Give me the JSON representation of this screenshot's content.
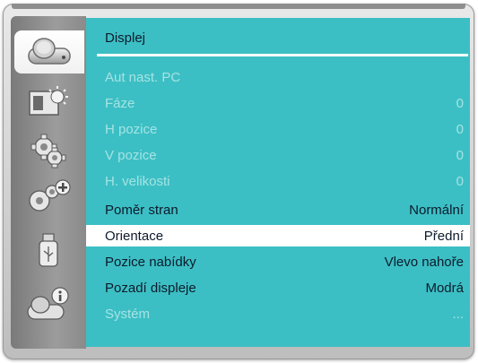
{
  "sidebar": {
    "icons": [
      {
        "name": "display-icon",
        "active": true
      },
      {
        "name": "picture-brightness-icon"
      },
      {
        "name": "settings-gears-icon"
      },
      {
        "name": "extended-settings-icon"
      },
      {
        "name": "usb-icon"
      },
      {
        "name": "info-icon"
      }
    ]
  },
  "panel": {
    "title": "Displej",
    "rows": [
      {
        "label": "Aut nast. PC",
        "value": "",
        "state": "disabled"
      },
      {
        "label": "Fáze",
        "value": "0",
        "state": "disabled"
      },
      {
        "label": "H pozice",
        "value": "0",
        "state": "disabled"
      },
      {
        "label": "V pozice",
        "value": "0",
        "state": "disabled"
      },
      {
        "label": "H. velikosti",
        "value": "0",
        "state": "disabled"
      },
      {
        "label": "Poměr stran",
        "value": "Normální",
        "state": "enabled"
      },
      {
        "label": "Orientace",
        "value": "Přední",
        "state": "selected"
      },
      {
        "label": "Pozice nabídky",
        "value": "Vlevo nahoře",
        "state": "enabled"
      },
      {
        "label": "Pozadí displeje",
        "value": "Modrá",
        "state": "enabled"
      },
      {
        "label": "Systém",
        "value": "...",
        "state": "disabled"
      }
    ]
  },
  "colors": {
    "panel_bg": "#3cbfc4",
    "text_enabled": "#0d1b2c",
    "text_disabled": "#a5e3e4",
    "selected_bg": "#ffffff"
  }
}
